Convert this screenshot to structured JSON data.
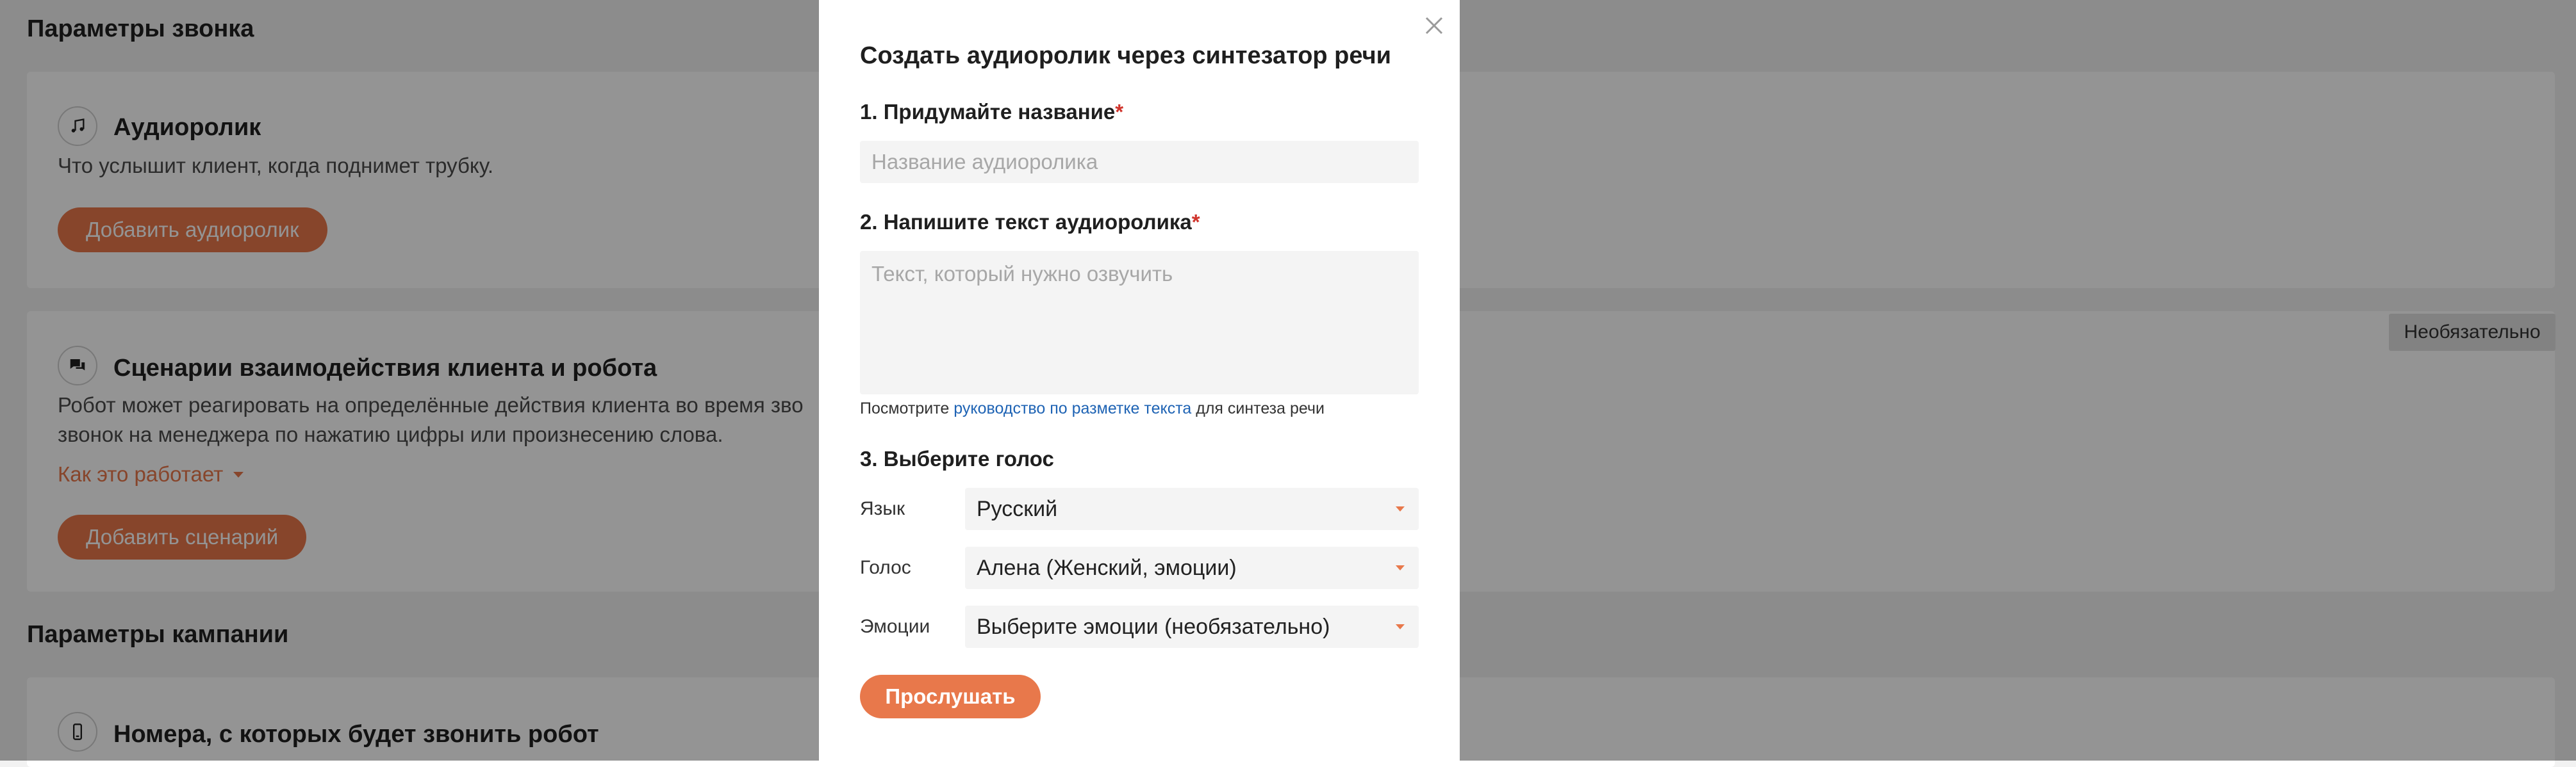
{
  "background": {
    "call_params_title": "Параметры звонка",
    "audio_card": {
      "title": "Аудиоролик",
      "description": "Что услышит клиент, когда поднимет трубку.",
      "add_button": "Добавить аудиоролик",
      "icon": "music-note-icon"
    },
    "scenario_card": {
      "title": "Сценарии взаимодействия клиента и робота",
      "description_line1": "Робот может реагировать на определённые действия клиента во время зво",
      "description_line2": "звонок на менеджера по нажатию цифры или произнесению слова.",
      "how_it_works": "Как это работает",
      "add_button": "Добавить сценарий",
      "optional_badge": "Необязательно",
      "icon": "chat-bubbles-icon"
    },
    "campaign_params_title": "Параметры кампании",
    "numbers_card": {
      "title": "Номера, с которых будет звонить робот",
      "icon": "phone-icon"
    }
  },
  "modal": {
    "title": "Создать аудиоролик через синтезатор речи",
    "step1_label": "1. Придумайте название",
    "step1_required": "*",
    "name_placeholder": "Название аудиоролика",
    "step2_label": "2. Напишите текст аудиоролика",
    "step2_required": "*",
    "text_placeholder": "Текст, который нужно озвучить",
    "hint_prefix": "Посмотрите ",
    "hint_link": "руководство по разметке текста",
    "hint_suffix": " для синтеза речи",
    "step3_label": "3. Выберите голос",
    "language_label": "Язык",
    "language_value": "Русский",
    "voice_label": "Голос",
    "voice_value": "Алена (Женский, эмоции)",
    "emotions_label": "Эмоции",
    "emotions_value": "Выберите эмоции (необязательно)",
    "listen_button": "Прослушать"
  },
  "colors": {
    "accent": "#e8784b",
    "link": "#1e63b4",
    "required": "#d0342c"
  }
}
